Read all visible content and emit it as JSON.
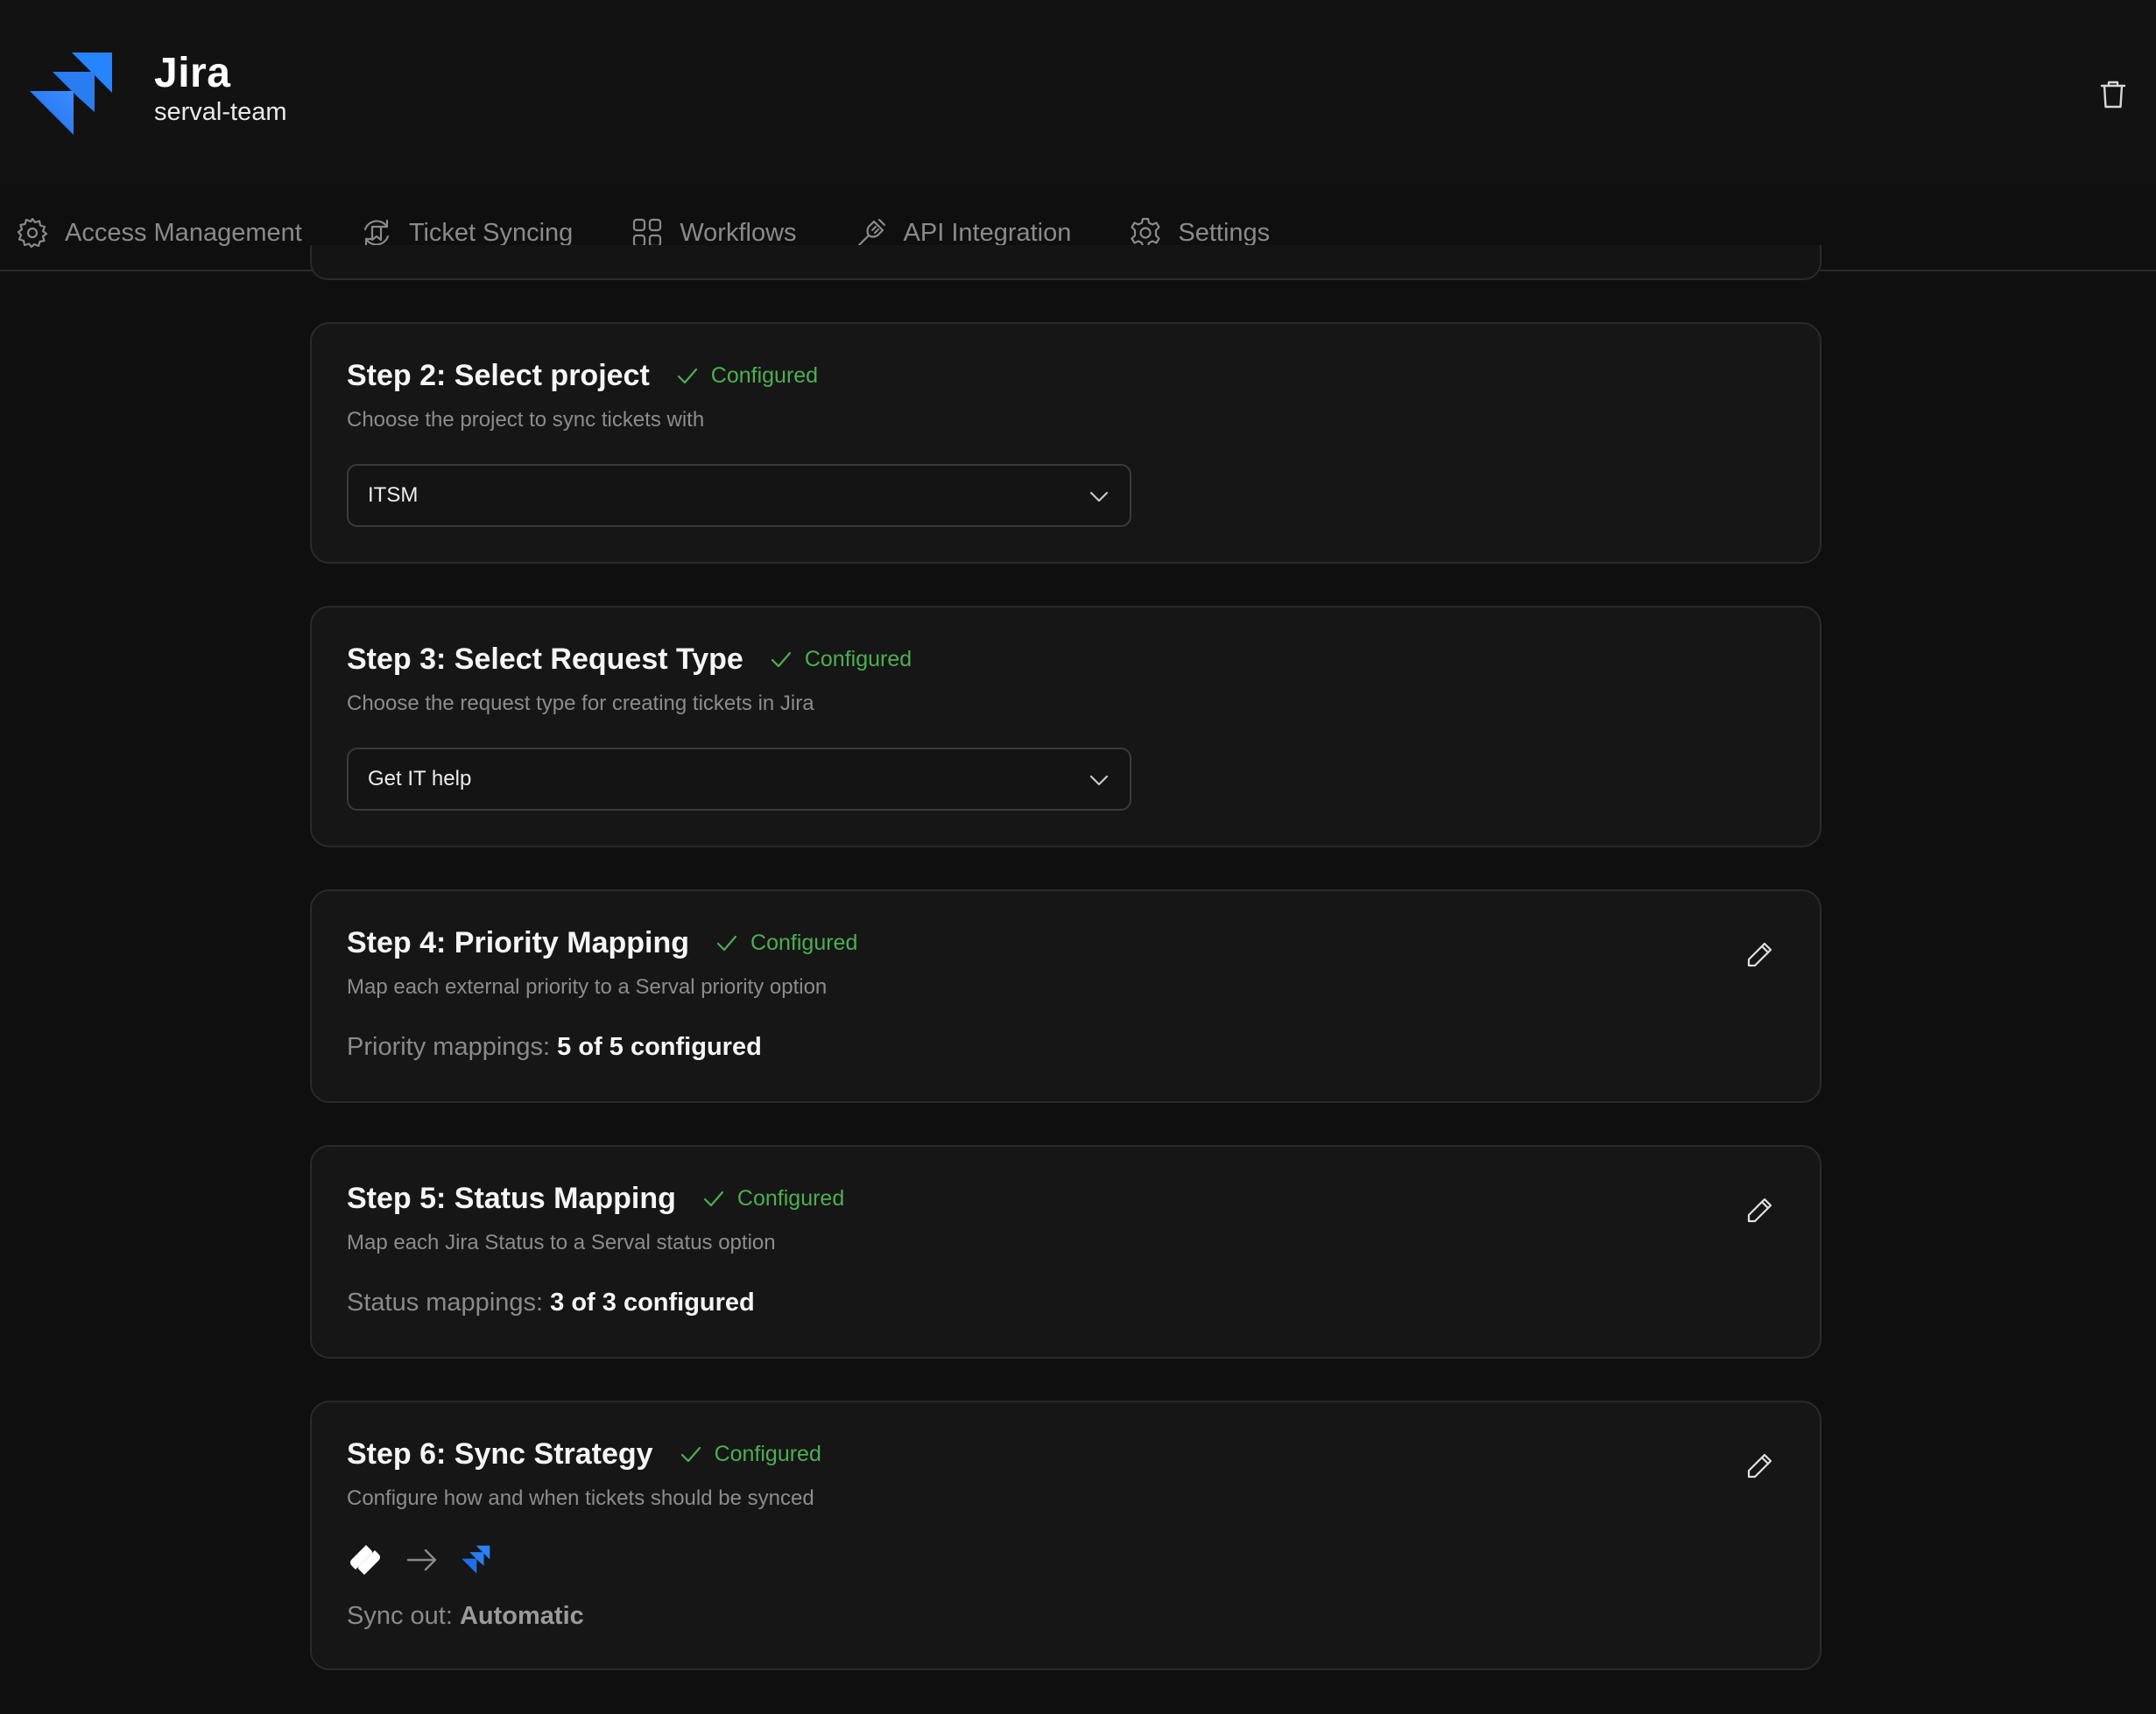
{
  "app": {
    "title": "Jira",
    "workspace": "serval-team",
    "logo_icon": "jira-logo",
    "accent_color": "#2684ff"
  },
  "tabs": [
    {
      "label": "Access Management",
      "icon": "access-gear-icon"
    },
    {
      "label": "Ticket Syncing",
      "icon": "sync-icon"
    },
    {
      "label": "Workflows",
      "icon": "workflow-icon"
    },
    {
      "label": "API Integration",
      "icon": "plug-icon"
    },
    {
      "label": "Settings",
      "icon": "gear-icon"
    }
  ],
  "steps": [
    {
      "title": "Step 2: Select project",
      "status": "Configured",
      "description": "Choose the project to sync tickets with",
      "select_value": "ITSM"
    },
    {
      "title": "Step 3: Select Request Type",
      "status": "Configured",
      "description": "Choose the request type for creating tickets in Jira",
      "select_value": "Get IT help"
    },
    {
      "title": "Step 4: Priority Mapping",
      "status": "Configured",
      "description": "Map each external priority to a Serval priority option",
      "mapping_label": "Priority mappings: ",
      "mapping_value": "5 of 5 configured"
    },
    {
      "title": "Step 5: Status Mapping",
      "status": "Configured",
      "description": "Map each Jira Status to a Serval status option",
      "mapping_label": "Status mappings: ",
      "mapping_value": "3 of 3 configured"
    },
    {
      "title": "Step 6: Sync Strategy",
      "status": "Configured",
      "description": "Configure how and when tickets should be synced",
      "sync_label": "Sync out: ",
      "sync_value": "Automatic"
    }
  ],
  "colors": {
    "configured": "#4caf50",
    "background": "#0f0f0f",
    "card": "#161616"
  }
}
